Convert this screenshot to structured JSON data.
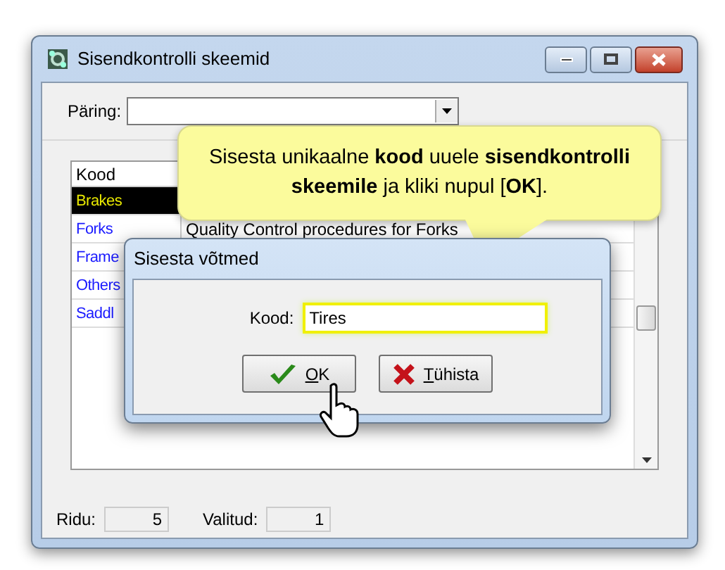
{
  "window": {
    "title": "Sisendkontrolli skeemid"
  },
  "query": {
    "label": "Päring:"
  },
  "grid": {
    "columns": [
      "Kood"
    ],
    "rows": [
      {
        "code": "Brakes",
        "selected": true
      },
      {
        "code": "Forks",
        "selected": false,
        "description": "Quality Control procedures for Forks"
      },
      {
        "code": "Frame",
        "selected": false
      },
      {
        "code": "Others",
        "selected": false
      },
      {
        "code": "Saddl",
        "selected": false
      }
    ]
  },
  "callout": {
    "text": "Sisesta unikaalne **kood** uuele **sisendkontrolli skeemile** ja kliki nupul [**OK**]."
  },
  "dialog": {
    "title": "Sisesta võtmed",
    "field_label": "Kood:",
    "field_value": "Tires",
    "buttons": [
      {
        "label": "OK",
        "kind": "ok"
      },
      {
        "label": "Tühista",
        "kind": "cancel"
      }
    ]
  },
  "status_bar": {
    "rows_label": "Ridu:",
    "rows_value": "5",
    "selected_label": "Valitud:",
    "selected_value": "1"
  }
}
